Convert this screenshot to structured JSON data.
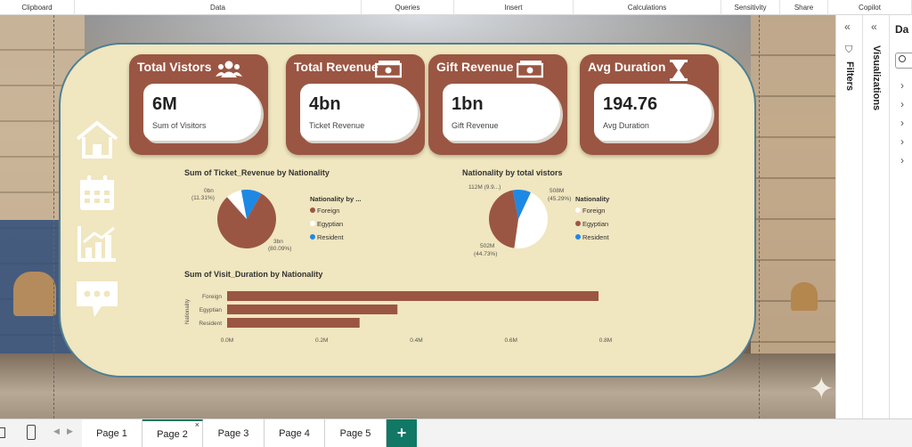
{
  "ribbon": [
    "Clipboard",
    "Data",
    "Queries",
    "Insert",
    "Calculations",
    "Sensitivity",
    "Share",
    "Copilot"
  ],
  "kpis": [
    {
      "title": "Total Vistors",
      "value": "6M",
      "sub": "Sum of Visitors",
      "icon": "users-icon"
    },
    {
      "title": "Total Revenue",
      "value": "4bn",
      "sub": "Ticket Revenue",
      "icon": "money-icon"
    },
    {
      "title": "Gift Revenue",
      "value": "1bn",
      "sub": "Gift Revenue",
      "icon": "money-icon"
    },
    {
      "title": "Avg Duration",
      "value": "194.76",
      "sub": "Avg Duration",
      "icon": "hourglass-icon"
    }
  ],
  "nav_icons": [
    "home-icon",
    "calendar-icon",
    "bar-chart-icon",
    "chat-icon"
  ],
  "colors": {
    "brown": "#9a5643",
    "white": "#ffffff",
    "blue": "#1e88e5",
    "card": "#f0e6bf",
    "accent": "#117865"
  },
  "pie1": {
    "title": "Sum of Ticket_Revenue by Nationality",
    "legend_title": "Nationality by ...",
    "labels": {
      "top": "0bn",
      "top_pct": "(11.31%)",
      "bottom": "3bn",
      "bottom_pct": "(80.09%)"
    }
  },
  "pie2": {
    "title": "Nationality by total vistors",
    "legend_title": "Nationality",
    "labels": {
      "top_left": "112M (9.9...)",
      "right": "508M",
      "right_pct": "(45.29%)",
      "bottom": "502M",
      "bottom_pct": "(44.73%)"
    }
  },
  "legend_items": [
    "Foreign",
    "Egyptian",
    "Resident"
  ],
  "bar": {
    "title": "Sum of Visit_Duration by Nationality",
    "ylabel": "Nationality",
    "xticks": [
      "0.0M",
      "0.2M",
      "0.4M",
      "0.6M",
      "0.8M"
    ]
  },
  "chart_data": [
    {
      "type": "pie",
      "title": "Sum of Ticket_Revenue by Nationality",
      "categories": [
        "Foreign",
        "Egyptian",
        "Resident"
      ],
      "values": [
        80.09,
        8.6,
        11.31
      ]
    },
    {
      "type": "pie",
      "title": "Nationality by total vistors",
      "categories": [
        "Foreign",
        "Egyptian",
        "Resident"
      ],
      "values": [
        45.29,
        44.73,
        9.98
      ]
    },
    {
      "type": "bar",
      "title": "Sum of Visit_Duration by Nationality",
      "categories": [
        "Foreign",
        "Egyptian",
        "Resident"
      ],
      "values": [
        0.785,
        0.36,
        0.28
      ],
      "ylabel": "Nationality",
      "xlim": [
        0,
        0.8
      ]
    }
  ],
  "panes": {
    "filters": "Filters",
    "visualizations": "Visualizations",
    "data": "Da"
  },
  "tabs": [
    "Page 1",
    "Page 2",
    "Page 3",
    "Page 4",
    "Page 5"
  ],
  "active_tab": "Page 2",
  "add_tab": "+",
  "close_tab": "×"
}
